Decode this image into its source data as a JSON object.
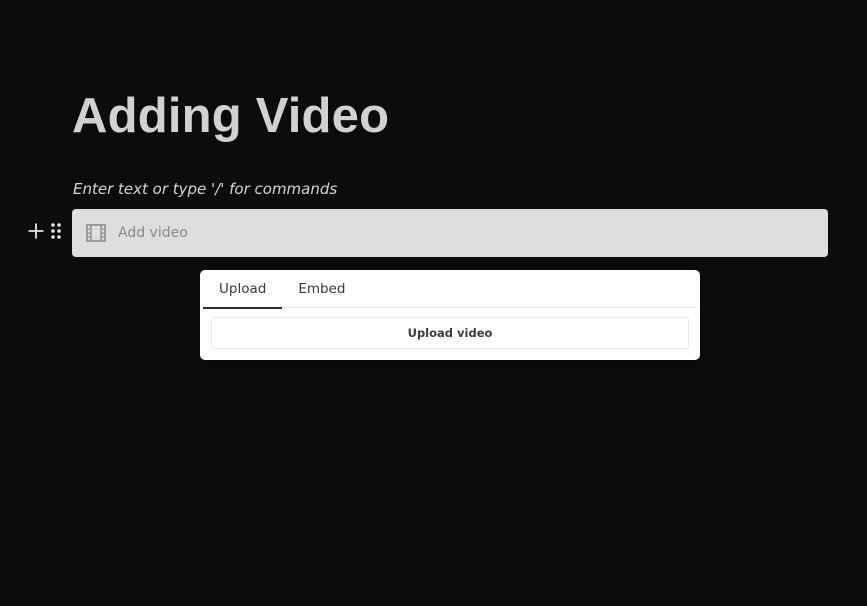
{
  "document": {
    "title": "Adding Video",
    "empty_block_placeholder": "Enter text or type '/' for commands"
  },
  "block_controls": {
    "add_icon": "plus-icon",
    "drag_icon": "drag-handle-icon"
  },
  "video_block": {
    "icon": "film-icon",
    "label": "Add video"
  },
  "popover": {
    "tabs": [
      {
        "label": "Upload",
        "active": true
      },
      {
        "label": "Embed",
        "active": false
      }
    ],
    "upload_button_label": "Upload video"
  },
  "colors": {
    "background": "#0d0c0c",
    "title": "#d2d0d0",
    "block_background": "#dedede",
    "popover_background": "#ffffff"
  }
}
